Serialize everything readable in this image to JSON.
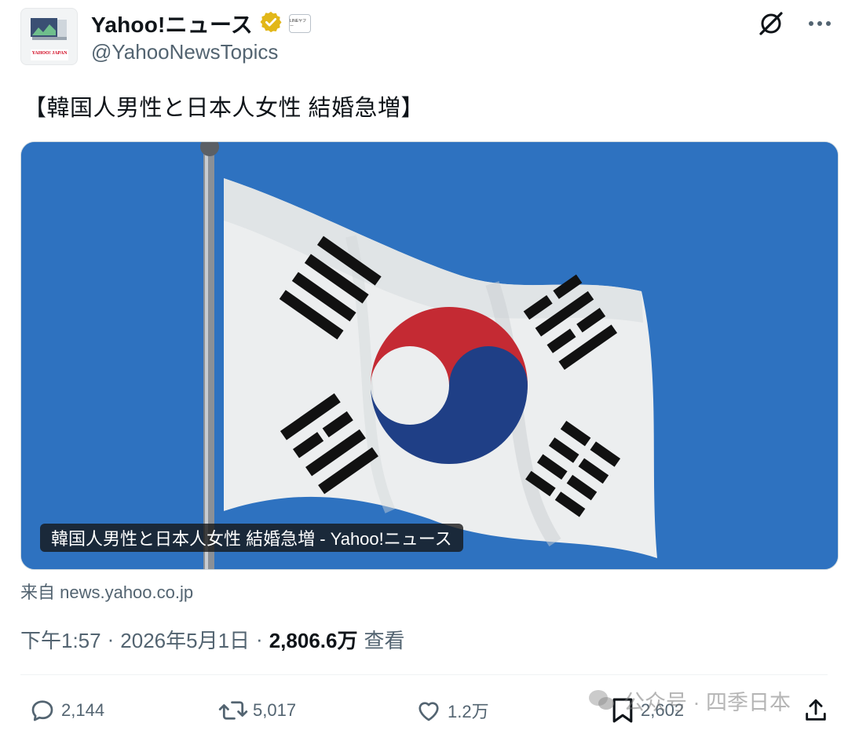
{
  "author": {
    "display_name": "Yahoo!ニュース",
    "handle": "@YahooNewsTopics",
    "avatar_logo_text": "YAHOO! JAPAN",
    "affiliate_badge_text": "LINEヤフー"
  },
  "icons": {
    "grok": "grok-icon",
    "more": "more-icon",
    "verified": "verified-badge-icon"
  },
  "tweet": {
    "text": "【韓国人男性と日本人女性 結婚急増】"
  },
  "card": {
    "caption": "韓国人男性と日本人女性 結婚急増 - Yahoo!ニュース",
    "source": "来自 news.yahoo.co.jp"
  },
  "meta": {
    "time": "下午1:57",
    "date": "2026年5月1日",
    "views": "2,806.6万",
    "views_label": "查看"
  },
  "actions": {
    "replies": "2,144",
    "reposts": "5,017",
    "likes": "1.2万",
    "bookmarks": "2,602"
  },
  "watermark": {
    "text": "公众号 · 四季日本"
  },
  "colors": {
    "verified_gold": "#e2b719",
    "sky_blue": "#2e72c0",
    "flag_red": "#c42a33",
    "flag_blue": "#1f3f86"
  }
}
